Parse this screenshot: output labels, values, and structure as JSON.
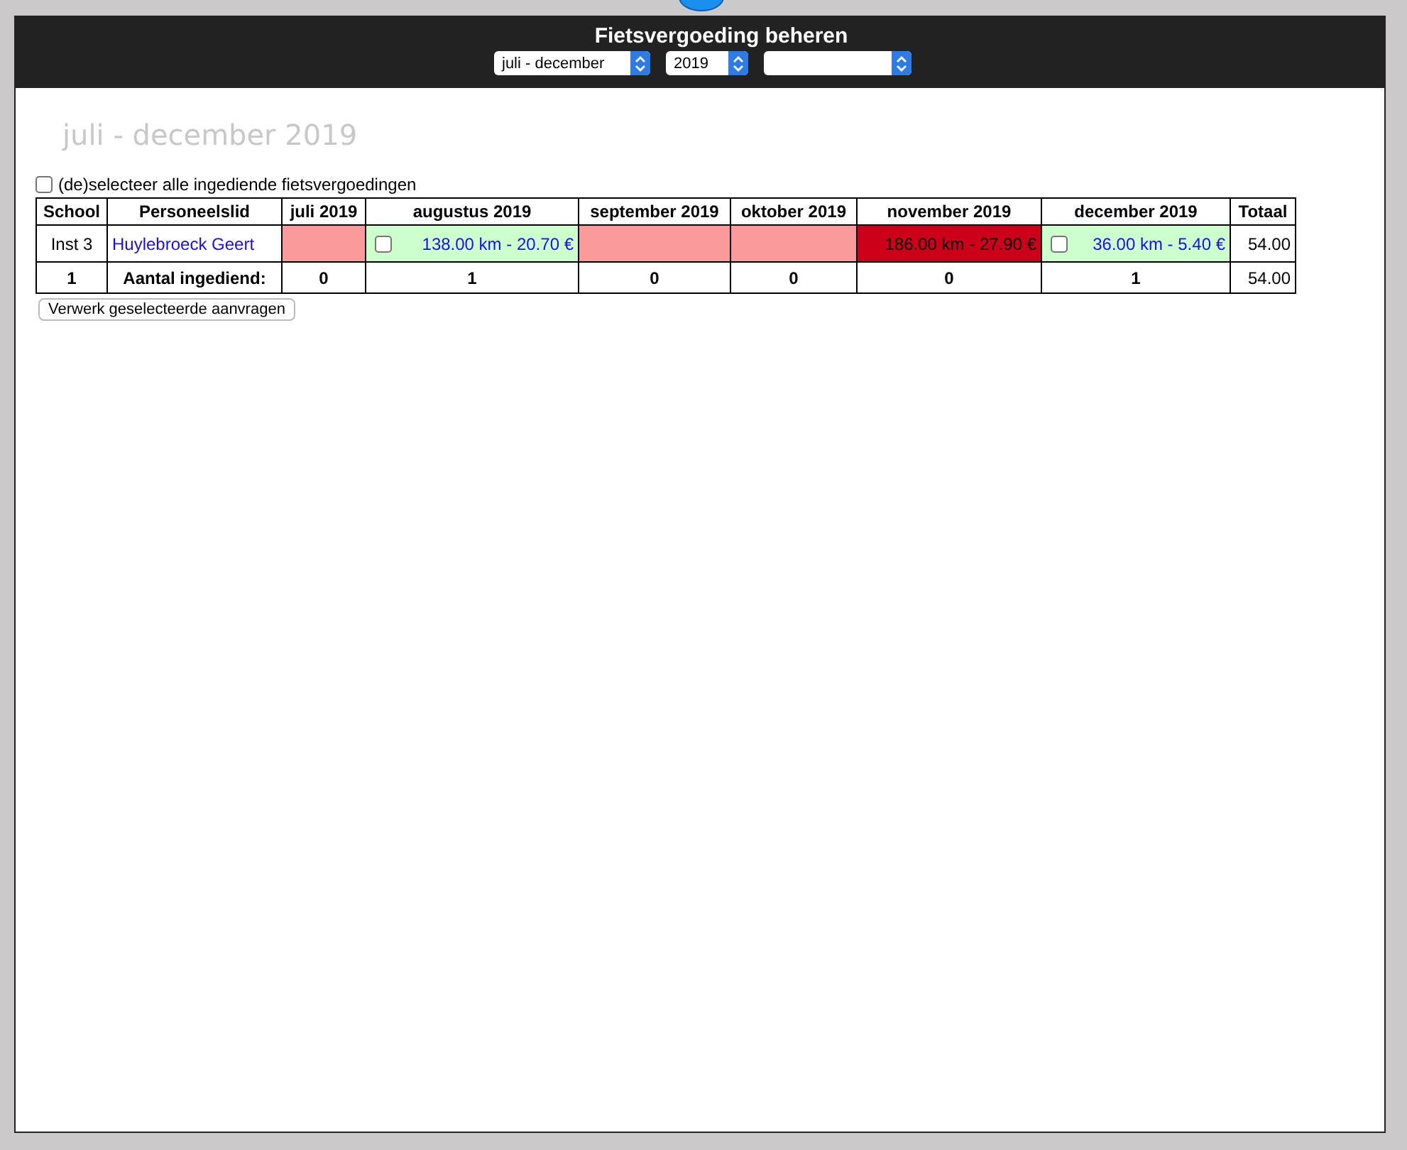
{
  "header": {
    "title": "Fietsvergoeding beheren",
    "selects": [
      {
        "kind": "filled",
        "value": "juli - december"
      },
      {
        "kind": "filled",
        "value": "2019"
      },
      {
        "kind": "blank"
      }
    ]
  },
  "period_heading": "juli - december 2019",
  "select_all": {
    "label": "(de)selecteer alle ingediende fietsvergoedingen",
    "checked": false
  },
  "table": {
    "columns": [
      "School",
      "Personeelslid",
      "juli 2019",
      "augustus 2019",
      "september 2019",
      "oktober 2019",
      "november 2019",
      "december 2019",
      "Totaal"
    ],
    "rows": [
      {
        "school": "Inst 3",
        "name": "Huylebroeck Geert",
        "months": [
          {
            "kind": "missing"
          },
          {
            "kind": "submitted",
            "text": "138.00 km - 20.70 €",
            "checked": false
          },
          {
            "kind": "missing"
          },
          {
            "kind": "missing"
          },
          {
            "kind": "rejected",
            "text": "186.00 km - 27.90 €"
          },
          {
            "kind": "submitted",
            "text": "36.00 km - 5.40 €",
            "checked": false
          }
        ],
        "total": "54.00"
      }
    ],
    "footer": {
      "count": "1",
      "label": "Aantal ingediend:",
      "months": [
        "0",
        "1",
        "0",
        "0",
        "0",
        "1"
      ],
      "total": "54.00"
    }
  },
  "process_button": "Verwerk geselecteerde aanvragen"
}
